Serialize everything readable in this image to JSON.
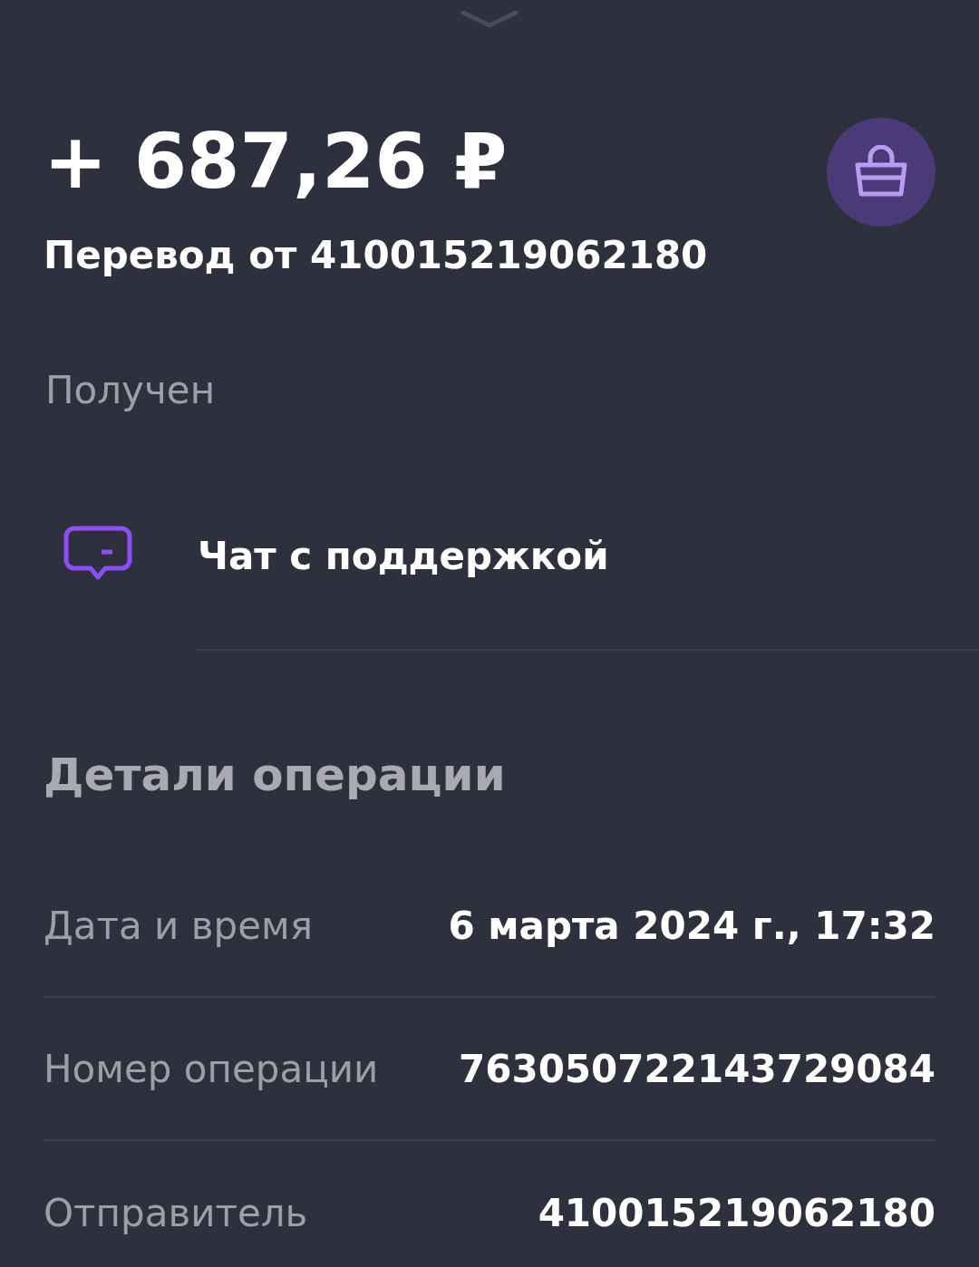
{
  "amount": "+ 687,26 ₽",
  "title": "Перевод от 410015219062180",
  "status": "Получен",
  "support": {
    "label": "Чат с поддержкой"
  },
  "details": {
    "heading": "Детали операции",
    "rows": [
      {
        "label": "Дата и время",
        "value": "6 марта 2024 г., 17:32"
      },
      {
        "label": "Номер операции",
        "value": "763050722143729084"
      },
      {
        "label": "Отправитель",
        "value": "410015219062180"
      }
    ]
  }
}
